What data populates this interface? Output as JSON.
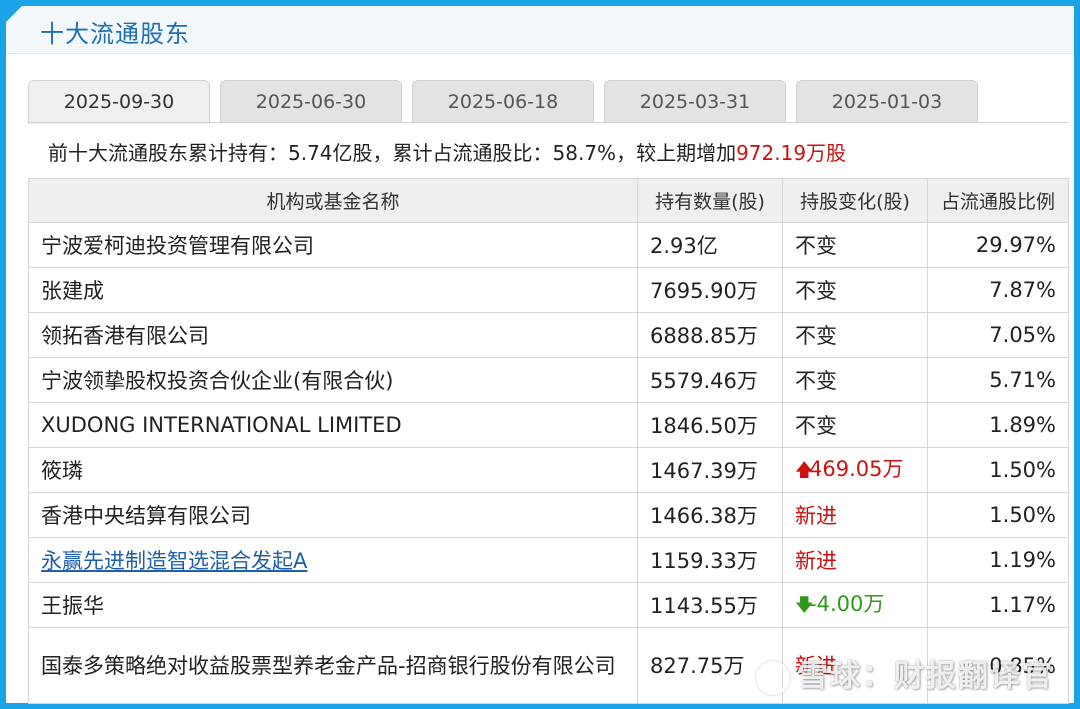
{
  "header": {
    "title": "十大流通股东"
  },
  "tabs": [
    {
      "label": "2025-09-30",
      "active": true
    },
    {
      "label": "2025-06-30",
      "active": false
    },
    {
      "label": "2025-06-18",
      "active": false
    },
    {
      "label": "2025-03-31",
      "active": false
    },
    {
      "label": "2025-01-03",
      "active": false
    }
  ],
  "summary": {
    "prefix": "前十大流通股东累计持有：5.74亿股，累计占流通股比：58.7%，较上期增加",
    "increase": "972.19万股"
  },
  "table": {
    "headers": [
      "机构或基金名称",
      "持有数量(股)",
      "持股变化(股)",
      "占流通股比例"
    ],
    "rows": [
      {
        "name": "宁波爱柯迪投资管理有限公司",
        "shares": "2.93亿",
        "change": "不变",
        "change_type": "none",
        "ratio": "29.97%"
      },
      {
        "name": "张建成",
        "shares": "7695.90万",
        "change": "不变",
        "change_type": "none",
        "ratio": "7.87%"
      },
      {
        "name": "领拓香港有限公司",
        "shares": "6888.85万",
        "change": "不变",
        "change_type": "none",
        "ratio": "7.05%"
      },
      {
        "name": "宁波领挚股权投资合伙企业(有限合伙)",
        "shares": "5579.46万",
        "change": "不变",
        "change_type": "none",
        "ratio": "5.71%"
      },
      {
        "name": "XUDONG INTERNATIONAL LIMITED",
        "shares": "1846.50万",
        "change": "不变",
        "change_type": "none",
        "ratio": "1.89%"
      },
      {
        "name": "筱璘",
        "shares": "1467.39万",
        "change": "469.05万",
        "change_type": "up",
        "ratio": "1.50%"
      },
      {
        "name": "香港中央结算有限公司",
        "shares": "1466.38万",
        "change": "新进",
        "change_type": "new",
        "ratio": "1.50%"
      },
      {
        "name": "永赢先进制造智选混合发起A",
        "shares": "1159.33万",
        "change": "新进",
        "change_type": "new",
        "ratio": "1.19%",
        "link": true
      },
      {
        "name": "王振华",
        "shares": "1143.55万",
        "change": "-4.00万",
        "change_type": "down",
        "ratio": "1.17%"
      },
      {
        "name": "国泰多策略绝对收益股票型养老金产品-招商银行股份有限公司",
        "shares": "827.75万",
        "change": "新进",
        "change_type": "new",
        "ratio": "0.85%"
      }
    ]
  },
  "watermark": {
    "text": "雪球：财报翻译官"
  },
  "colors": {
    "accent": "#1aa3e6",
    "title": "#1e6fb5",
    "increase": "#cc1111",
    "decrease": "#2f9a1a"
  }
}
